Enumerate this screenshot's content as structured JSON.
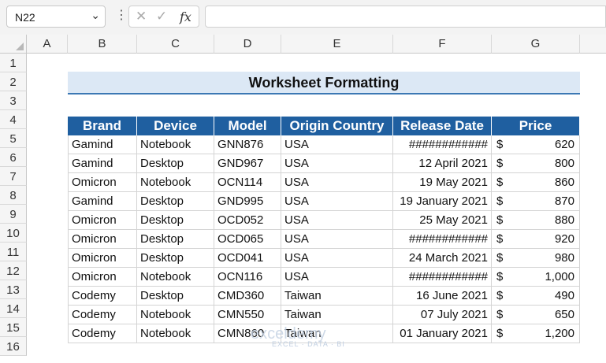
{
  "formula_bar": {
    "name_box": "N22",
    "fx_label": "fx",
    "formula": ""
  },
  "columns": [
    "A",
    "B",
    "C",
    "D",
    "E",
    "F",
    "G"
  ],
  "rows": [
    "1",
    "2",
    "3",
    "4",
    "5",
    "6",
    "7",
    "8",
    "9",
    "10",
    "11",
    "12",
    "13",
    "14",
    "15",
    "16"
  ],
  "sheet": {
    "title": "Worksheet Formatting",
    "headers": [
      "Brand",
      "Device",
      "Model",
      "Origin Country",
      "Release Date",
      "Price"
    ],
    "currency_symbol": "$",
    "data": [
      [
        "Gamind",
        "Notebook",
        "GNN876",
        "USA",
        "############",
        "620"
      ],
      [
        "Gamind",
        "Desktop",
        "GND967",
        "USA",
        "12 April 2021",
        "800"
      ],
      [
        "Omicron",
        "Notebook",
        "OCN114",
        "USA",
        "19 May 2021",
        "860"
      ],
      [
        "Gamind",
        "Desktop",
        "GND995",
        "USA",
        "19 January 2021",
        "870"
      ],
      [
        "Omicron",
        "Desktop",
        "OCD052",
        "USA",
        "25 May 2021",
        "880"
      ],
      [
        "Omicron",
        "Desktop",
        "OCD065",
        "USA",
        "############",
        "920"
      ],
      [
        "Omicron",
        "Desktop",
        "OCD041",
        "USA",
        "24 March 2021",
        "980"
      ],
      [
        "Omicron",
        "Notebook",
        "OCN116",
        "USA",
        "############",
        "1,000"
      ],
      [
        "Codemy",
        "Desktop",
        "CMD360",
        "Taiwan",
        "16 June 2021",
        "490"
      ],
      [
        "Codemy",
        "Notebook",
        "CMN550",
        "Taiwan",
        "07 July 2021",
        "650"
      ],
      [
        "Codemy",
        "Notebook",
        "CMN860",
        "Taiwan",
        "01 January 2021",
        "1,200"
      ]
    ]
  },
  "watermark": {
    "name": "exceldemy",
    "tagline": "EXCEL · DATA · BI"
  },
  "colors": {
    "header_fill": "#1f5fa0",
    "title_fill": "#dce8f5",
    "title_border": "#3c78b4"
  }
}
